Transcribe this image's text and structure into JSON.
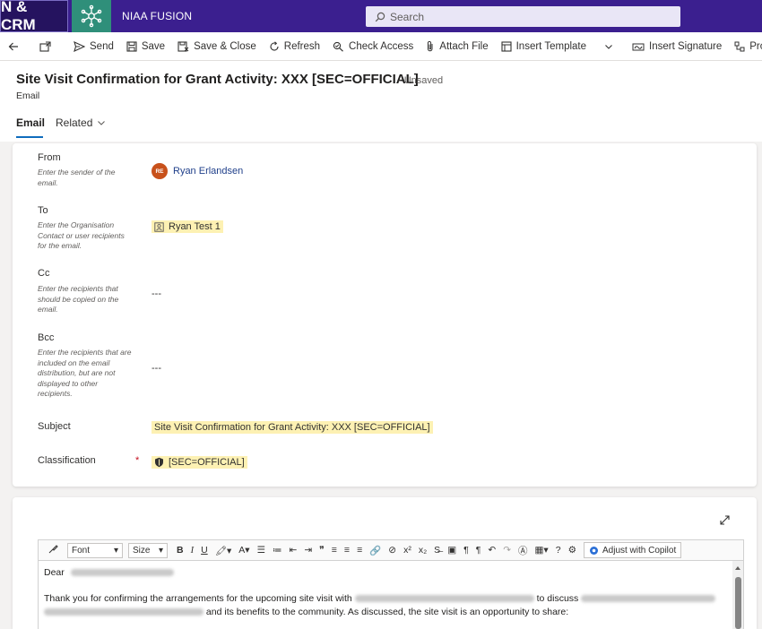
{
  "header": {
    "app_name": "N & CRM",
    "brand": "NIAA FUSION",
    "search_placeholder": "Search"
  },
  "commands": {
    "send": "Send",
    "save": "Save",
    "save_close": "Save & Close",
    "refresh": "Refresh",
    "check_access": "Check Access",
    "attach_file": "Attach File",
    "insert_template": "Insert Template",
    "insert_signature": "Insert Signature",
    "process": "Process"
  },
  "record": {
    "title": "Site Visit Confirmation for Grant Activity: XXX [SEC=OFFICIAL]",
    "status": "- Unsaved",
    "entity": "Email"
  },
  "tabs": {
    "email": "Email",
    "related": "Related"
  },
  "form": {
    "from_label": "From",
    "from_hint": "Enter the sender of the email.",
    "from_initials": "RE",
    "from_value": "Ryan Erlandsen",
    "to_label": "To",
    "to_hint": "Enter the Organisation Contact or user recipients for the email.",
    "to_value": "Ryan Test 1",
    "cc_label": "Cc",
    "cc_hint": "Enter the recipients that should be copied on the email.",
    "cc_value": "---",
    "bcc_label": "Bcc",
    "bcc_hint": "Enter the recipients that are included on the email distribution, but are not displayed to other recipients.",
    "bcc_value": "---",
    "subject_label": "Subject",
    "subject_value": "Site Visit Confirmation for Grant Activity: XXX [SEC=OFFICIAL]",
    "classification_label": "Classification",
    "required_marker": "*",
    "classification_value": "[SEC=OFFICIAL]"
  },
  "editor": {
    "font_label": "Font",
    "size_label": "Size",
    "copilot_label": "Adjust with Copilot",
    "dear": "Dear",
    "line1_a": "Thank you for confirming the arrangements for the upcoming site visit with",
    "line1_b": "to discuss",
    "line2_b": "and its benefits to the community. As discussed, the site visit is an opportunity to share:"
  }
}
